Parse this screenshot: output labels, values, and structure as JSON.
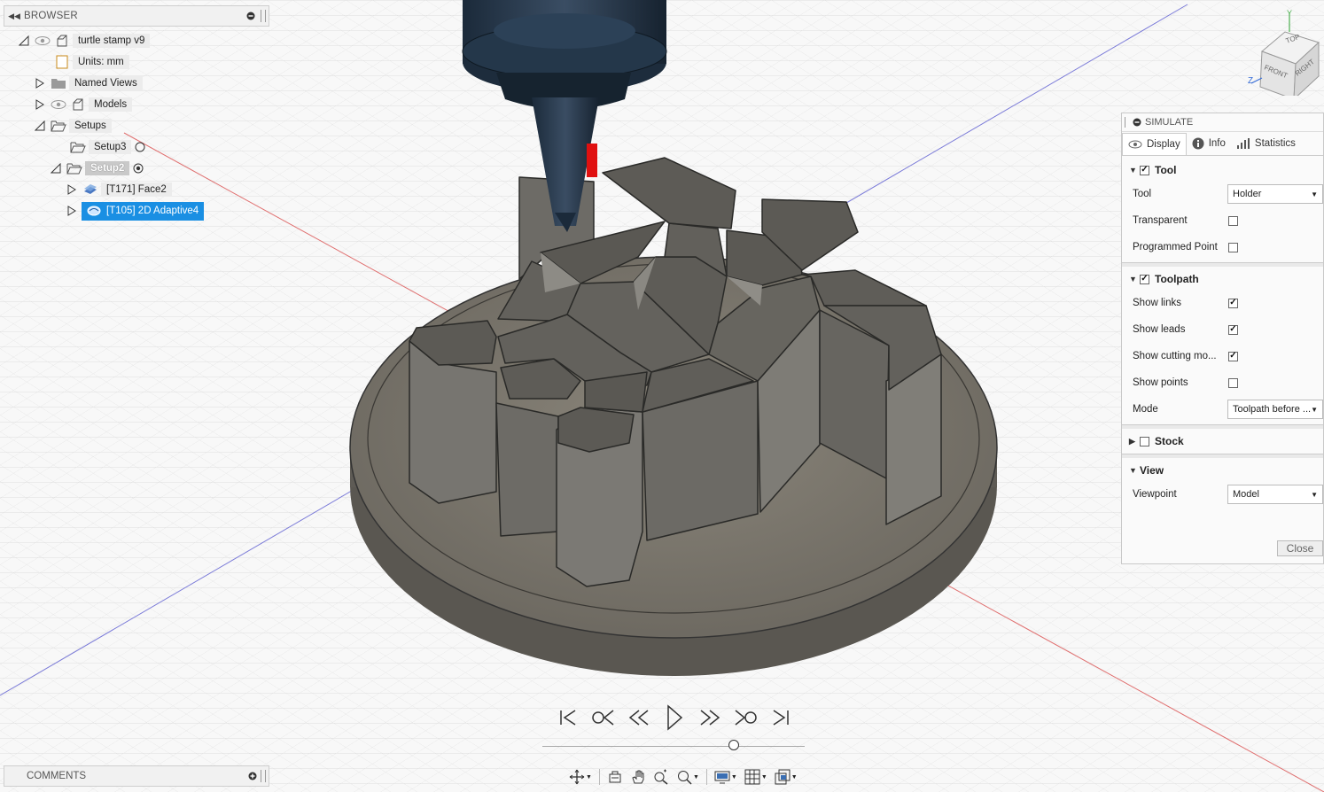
{
  "browser": {
    "title": "BROWSER",
    "items": [
      {
        "label": "turtle stamp v9"
      },
      {
        "label": "Units: mm"
      },
      {
        "label": "Named Views"
      },
      {
        "label": "Models"
      },
      {
        "label": "Setups"
      },
      {
        "label": "Setup3"
      },
      {
        "label": "Setup2"
      },
      {
        "label": "[T171] Face2"
      },
      {
        "label": "[T105] 2D Adaptive4"
      }
    ]
  },
  "comments": {
    "title": "COMMENTS"
  },
  "viewcube": {
    "top": "TOP",
    "front": "FRONT",
    "right": "RIGHT",
    "axis_y": "Y",
    "axis_z": "Z"
  },
  "simulate": {
    "title": "SIMULATE",
    "tabs": [
      {
        "label": "Display",
        "icon": "eye-icon"
      },
      {
        "label": "Info",
        "icon": "info-icon"
      },
      {
        "label": "Statistics",
        "icon": "statistics-icon"
      }
    ],
    "tool_section": {
      "label": "Tool",
      "checked": true,
      "tool_label": "Tool",
      "tool_value": "Holder",
      "transparent_label": "Transparent",
      "transparent_checked": false,
      "programmed_point_label": "Programmed Point",
      "programmed_point_checked": false
    },
    "toolpath_section": {
      "label": "Toolpath",
      "checked": true,
      "show_links_label": "Show links",
      "show_links": true,
      "show_leads_label": "Show leads",
      "show_leads": true,
      "show_cutting_label": "Show cutting mo...",
      "show_cutting": true,
      "show_points_label": "Show points",
      "show_points": false,
      "mode_label": "Mode",
      "mode_value": "Toolpath before ..."
    },
    "stock_section": {
      "label": "Stock",
      "checked": false
    },
    "view_section": {
      "label": "View",
      "viewpoint_label": "Viewpoint",
      "viewpoint_value": "Model"
    },
    "close_label": "Close"
  },
  "playback": {
    "position": 0.74
  }
}
